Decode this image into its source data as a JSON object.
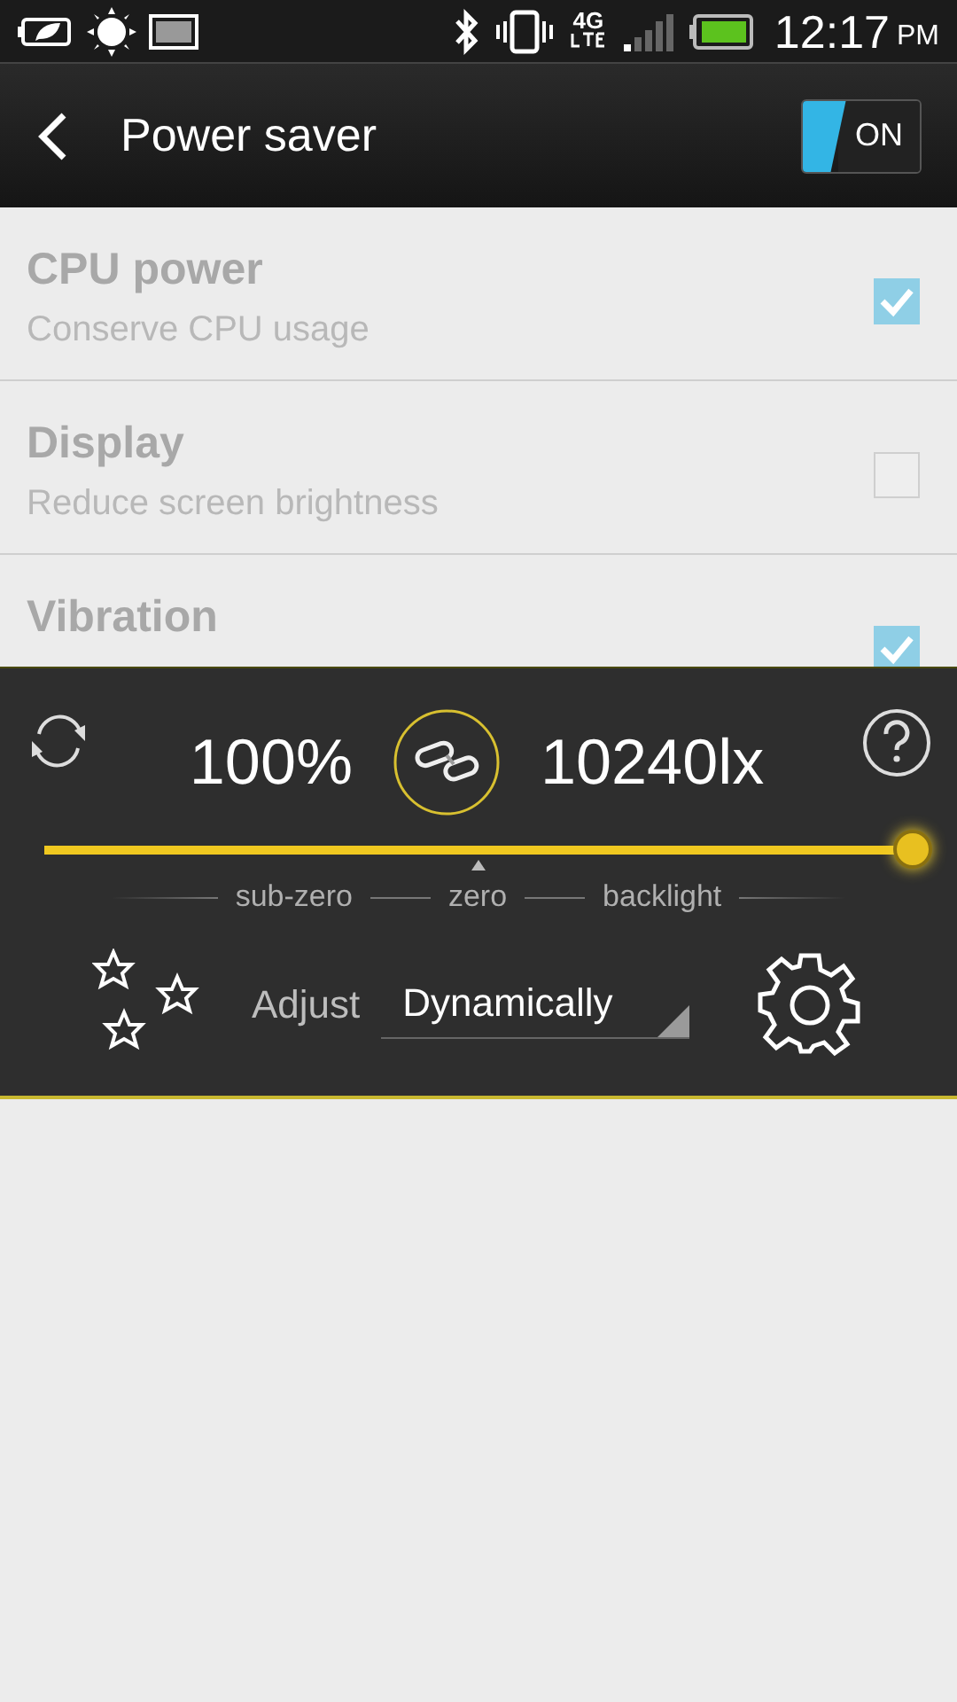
{
  "status_bar": {
    "time": "12:17",
    "ampm": "PM",
    "network": "4G"
  },
  "header": {
    "title": "Power saver",
    "toggle": {
      "label": "ON",
      "on": true
    }
  },
  "items": [
    {
      "title": "CPU power",
      "subtitle": "Conserve CPU usage",
      "checked": true
    },
    {
      "title": "Display",
      "subtitle": "Reduce screen brightness",
      "checked": false
    },
    {
      "title": "Vibration",
      "checked": true
    }
  ],
  "brightness_panel": {
    "percent": "100%",
    "lux": "10240lx",
    "slider": {
      "level": 1
    },
    "scale_labels": [
      "sub-zero",
      "zero",
      "backlight"
    ],
    "adjust_label": "Adjust",
    "mode": "Dynamically"
  }
}
